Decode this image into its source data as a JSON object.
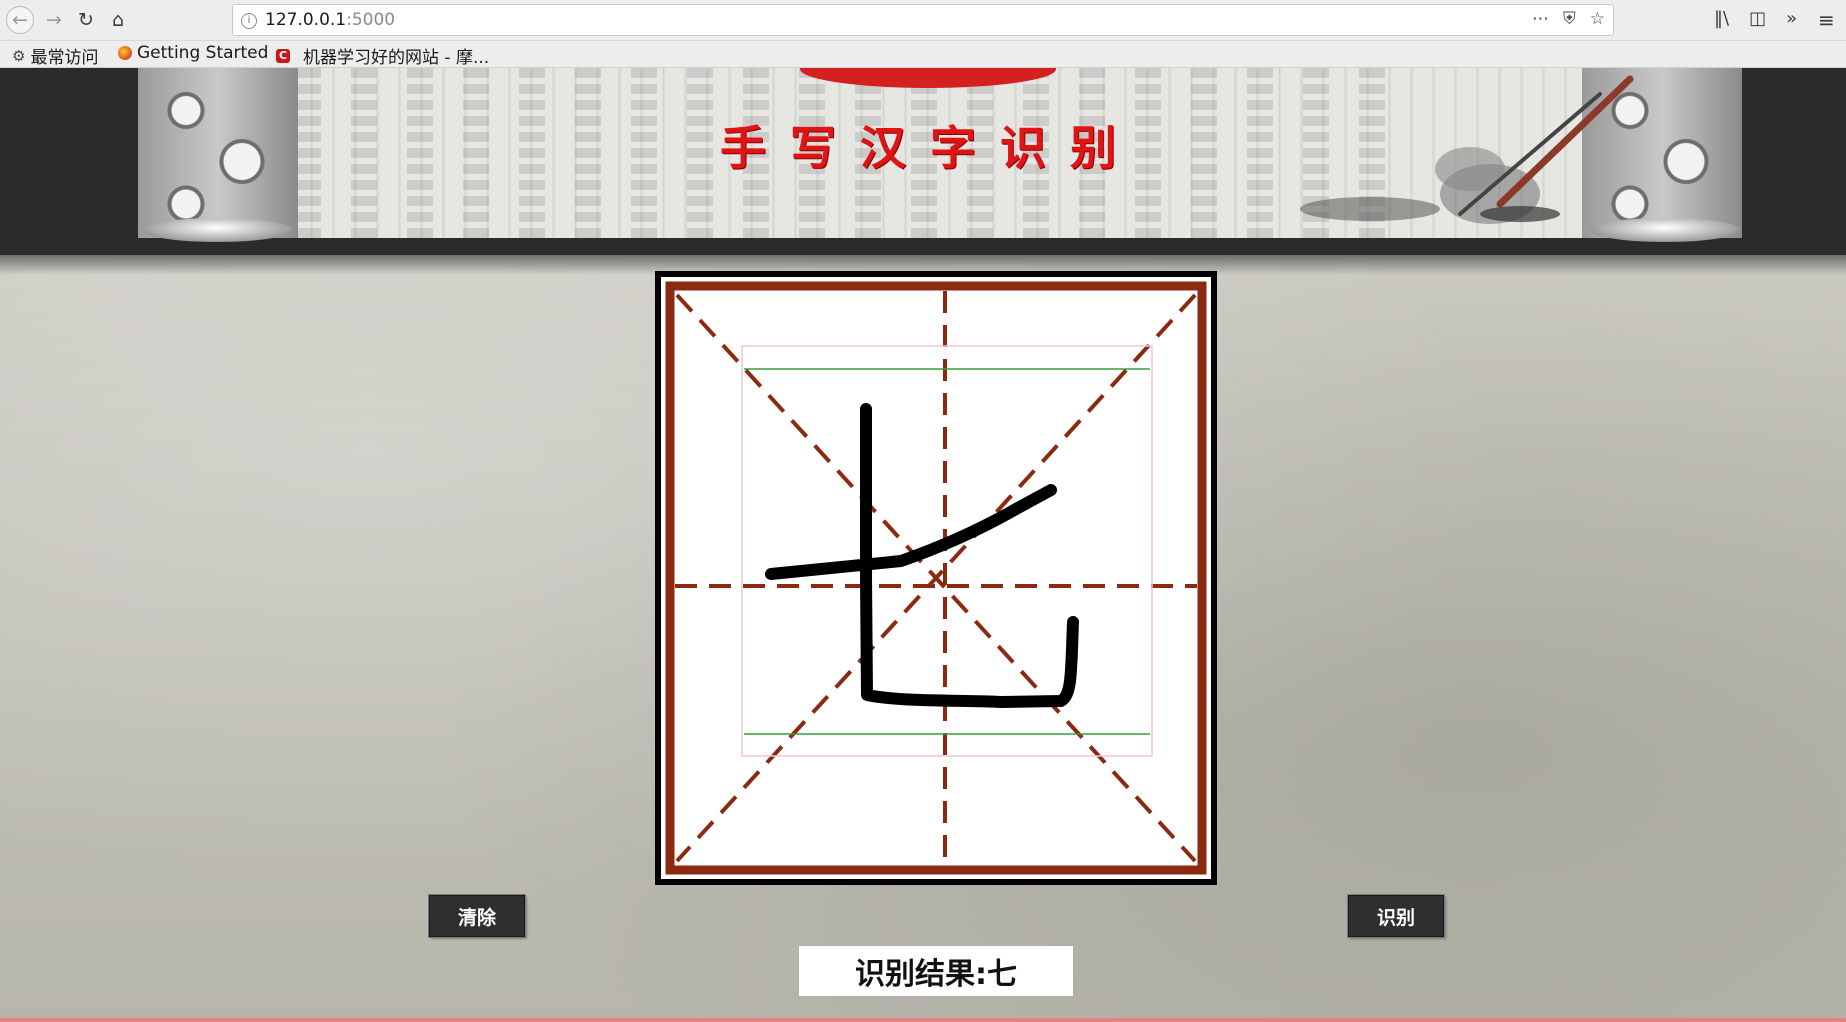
{
  "browser": {
    "url_host": "127.0.0.1",
    "url_port": ":5000",
    "bookmarks": [
      {
        "label": "最常访问",
        "icon": "gear-icon"
      },
      {
        "label": "Getting Started",
        "icon": "firefox-icon"
      },
      {
        "label": "机器学习好的网站 - 摩...",
        "icon": "c-logo-icon"
      }
    ]
  },
  "banner": {
    "title": "手写汉字识别",
    "title_color": "#e01414"
  },
  "canvas": {
    "grid_color": "#8b2a10",
    "drawn_character": "七"
  },
  "buttons": {
    "clear_label": "清除",
    "recognize_label": "识别"
  },
  "result": {
    "text": "识别结果:七"
  }
}
